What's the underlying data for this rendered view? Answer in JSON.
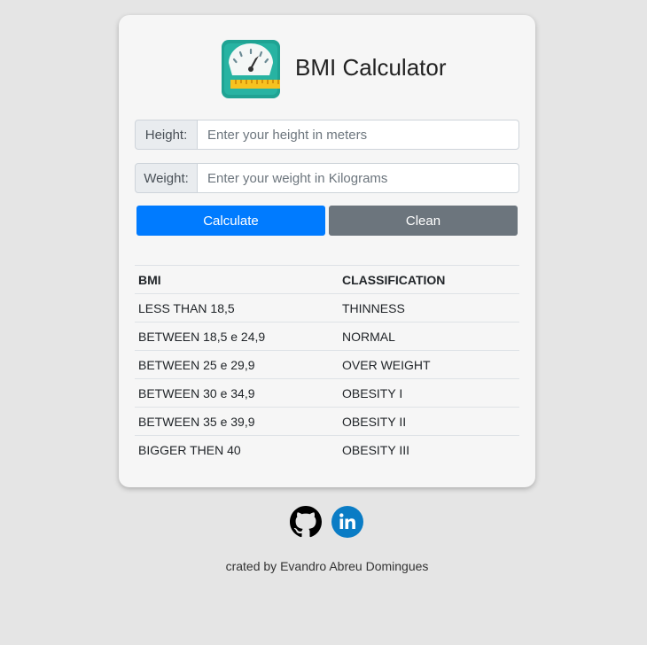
{
  "app": {
    "title": "BMI Calculator",
    "logo_icon": "scale-icon"
  },
  "form": {
    "height_label": "Height:",
    "height_placeholder": "Enter your height in meters",
    "height_value": "",
    "weight_label": "Weight:",
    "weight_placeholder": "Enter your weight in Kilograms",
    "weight_value": "",
    "calculate_label": "Calculate",
    "clean_label": "Clean"
  },
  "table": {
    "headers": [
      "BMI",
      "CLASSIFICATION"
    ],
    "rows": [
      [
        "LESS THAN 18,5",
        "THINNESS"
      ],
      [
        "BETWEEN 18,5 e 24,9",
        "NORMAL"
      ],
      [
        "BETWEEN 25 e 29,9",
        "OVER WEIGHT"
      ],
      [
        "BETWEEN 30 e 34,9",
        "OBESITY I"
      ],
      [
        "BETWEEN 35 e 39,9",
        "OBESITY II"
      ],
      [
        "BIGGER THEN 40",
        "OBESITY III"
      ]
    ]
  },
  "social": {
    "github_icon": "github-icon",
    "linkedin_icon": "linkedin-icon"
  },
  "footer": {
    "credit": "crated by Evandro Abreu Domingues"
  },
  "colors": {
    "primary": "#007bff",
    "secondary": "#6c757d",
    "page_bg": "#e5e5e5",
    "card_bg": "#f6f6f6",
    "linkedin": "#0a7cc5"
  }
}
